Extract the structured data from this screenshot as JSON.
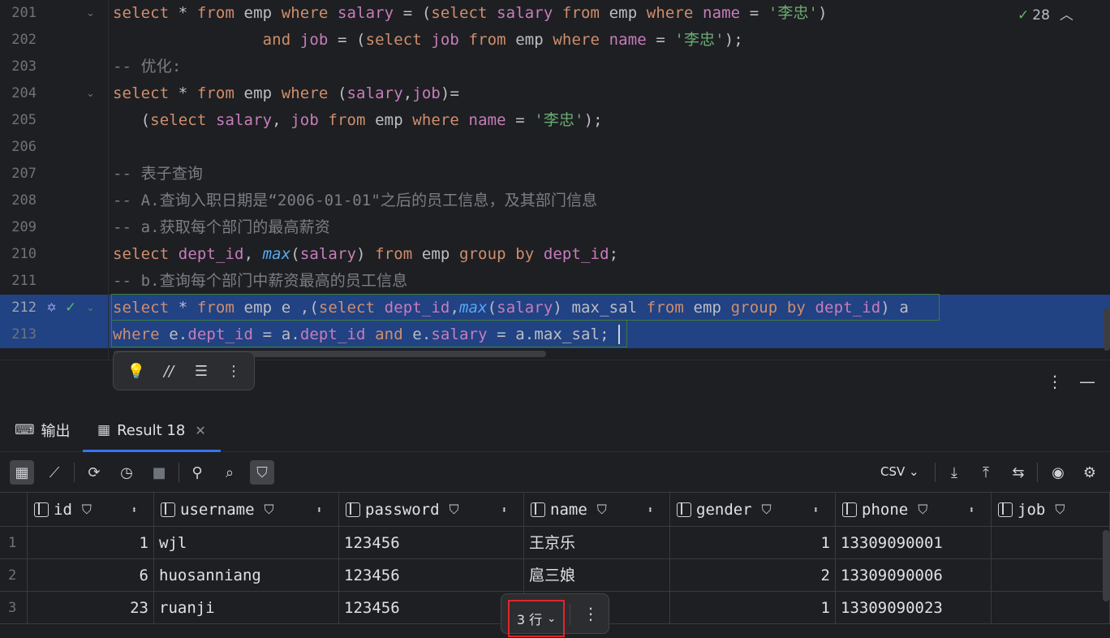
{
  "editor": {
    "lines": [
      {
        "num": "201",
        "fold": "⌄",
        "tokens": [
          {
            "t": "kw",
            "v": "select"
          },
          {
            "t": "",
            "v": " * "
          },
          {
            "t": "kw",
            "v": "from"
          },
          {
            "t": "",
            "v": " emp "
          },
          {
            "t": "kw",
            "v": "where"
          },
          {
            "t": "",
            "v": " "
          },
          {
            "t": "fld",
            "v": "salary"
          },
          {
            "t": "",
            "v": " = ("
          },
          {
            "t": "kw",
            "v": "select"
          },
          {
            "t": "",
            "v": " "
          },
          {
            "t": "fld",
            "v": "salary"
          },
          {
            "t": "",
            "v": " "
          },
          {
            "t": "kw",
            "v": "from"
          },
          {
            "t": "",
            "v": " emp "
          },
          {
            "t": "kw",
            "v": "where"
          },
          {
            "t": "",
            "v": " "
          },
          {
            "t": "fld",
            "v": "name"
          },
          {
            "t": "",
            "v": " = "
          },
          {
            "t": "str",
            "v": "'李忠'"
          },
          {
            "t": "",
            "v": ")"
          }
        ]
      },
      {
        "num": "202",
        "fold": "",
        "tokens": [
          {
            "t": "",
            "v": "                "
          },
          {
            "t": "kw",
            "v": "and"
          },
          {
            "t": "",
            "v": " "
          },
          {
            "t": "fld",
            "v": "job"
          },
          {
            "t": "",
            "v": " = ("
          },
          {
            "t": "kw",
            "v": "select"
          },
          {
            "t": "",
            "v": " "
          },
          {
            "t": "fld",
            "v": "job"
          },
          {
            "t": "",
            "v": " "
          },
          {
            "t": "kw",
            "v": "from"
          },
          {
            "t": "",
            "v": " emp "
          },
          {
            "t": "kw",
            "v": "where"
          },
          {
            "t": "",
            "v": " "
          },
          {
            "t": "fld",
            "v": "name"
          },
          {
            "t": "",
            "v": " = "
          },
          {
            "t": "str",
            "v": "'李忠'"
          },
          {
            "t": "",
            "v": ");"
          }
        ]
      },
      {
        "num": "203",
        "fold": "",
        "tokens": [
          {
            "t": "cmt",
            "v": "-- 优化:"
          }
        ]
      },
      {
        "num": "204",
        "fold": "⌄",
        "tokens": [
          {
            "t": "kw",
            "v": "select"
          },
          {
            "t": "",
            "v": " * "
          },
          {
            "t": "kw",
            "v": "from"
          },
          {
            "t": "",
            "v": " emp "
          },
          {
            "t": "kw",
            "v": "where"
          },
          {
            "t": "",
            "v": " ("
          },
          {
            "t": "fld",
            "v": "salary"
          },
          {
            "t": "",
            "v": ","
          },
          {
            "t": "fld",
            "v": "job"
          },
          {
            "t": "",
            "v": ")="
          }
        ]
      },
      {
        "num": "205",
        "fold": "",
        "tokens": [
          {
            "t": "",
            "v": "   ("
          },
          {
            "t": "kw",
            "v": "select"
          },
          {
            "t": "",
            "v": " "
          },
          {
            "t": "fld",
            "v": "salary"
          },
          {
            "t": "",
            "v": ", "
          },
          {
            "t": "fld",
            "v": "job"
          },
          {
            "t": "",
            "v": " "
          },
          {
            "t": "kw",
            "v": "from"
          },
          {
            "t": "",
            "v": " emp "
          },
          {
            "t": "kw",
            "v": "where"
          },
          {
            "t": "",
            "v": " "
          },
          {
            "t": "fld",
            "v": "name"
          },
          {
            "t": "",
            "v": " = "
          },
          {
            "t": "str",
            "v": "'李忠'"
          },
          {
            "t": "",
            "v": ");"
          }
        ]
      },
      {
        "num": "206",
        "fold": "",
        "tokens": []
      },
      {
        "num": "207",
        "fold": "",
        "tokens": [
          {
            "t": "cmt",
            "v": "-- 表子查询"
          }
        ]
      },
      {
        "num": "208",
        "fold": "",
        "tokens": [
          {
            "t": "cmt",
            "v": "-- A.查询入职日期是“2006-01-01\"之后的员工信息，及其部门信息"
          }
        ]
      },
      {
        "num": "209",
        "fold": "",
        "tokens": [
          {
            "t": "cmt",
            "v": "-- a.获取每个部门的最高薪资"
          }
        ]
      },
      {
        "num": "210",
        "fold": "",
        "tokens": [
          {
            "t": "kw",
            "v": "select"
          },
          {
            "t": "",
            "v": " "
          },
          {
            "t": "fld",
            "v": "dept_id"
          },
          {
            "t": "",
            "v": ", "
          },
          {
            "t": "fn",
            "v": "max"
          },
          {
            "t": "",
            "v": "("
          },
          {
            "t": "fld",
            "v": "salary"
          },
          {
            "t": "",
            "v": ") "
          },
          {
            "t": "kw",
            "v": "from"
          },
          {
            "t": "",
            "v": " emp "
          },
          {
            "t": "kw",
            "v": "group by"
          },
          {
            "t": "",
            "v": " "
          },
          {
            "t": "fld",
            "v": "dept_id"
          },
          {
            "t": "",
            "v": ";"
          }
        ]
      },
      {
        "num": "211",
        "fold": "",
        "tokens": [
          {
            "t": "cmt",
            "v": "-- b.查询每个部门中薪资最高的员工信息"
          }
        ]
      },
      {
        "num": "212",
        "fold": "⌄",
        "selected": true,
        "current": true,
        "tokens": [
          {
            "t": "kw",
            "v": "select"
          },
          {
            "t": "",
            "v": " * "
          },
          {
            "t": "kw",
            "v": "from"
          },
          {
            "t": "",
            "v": " emp e ,("
          },
          {
            "t": "kw",
            "v": "select"
          },
          {
            "t": "",
            "v": " "
          },
          {
            "t": "fld",
            "v": "dept_id"
          },
          {
            "t": "",
            "v": ","
          },
          {
            "t": "fn",
            "v": "max"
          },
          {
            "t": "",
            "v": "("
          },
          {
            "t": "fld",
            "v": "salary"
          },
          {
            "t": "",
            "v": ") max_sal "
          },
          {
            "t": "kw",
            "v": "from"
          },
          {
            "t": "",
            "v": " emp "
          },
          {
            "t": "kw",
            "v": "group by"
          },
          {
            "t": "",
            "v": " "
          },
          {
            "t": "fld",
            "v": "dept_id"
          },
          {
            "t": "",
            "v": ") a"
          }
        ]
      },
      {
        "num": "213",
        "fold": "",
        "selected": true,
        "tokens": [
          {
            "t": "kw",
            "v": "where"
          },
          {
            "t": "",
            "v": " e."
          },
          {
            "t": "fld",
            "v": "dept_id"
          },
          {
            "t": "",
            "v": " = a."
          },
          {
            "t": "fld",
            "v": "dept_id"
          },
          {
            "t": "",
            "v": " "
          },
          {
            "t": "kw",
            "v": "and"
          },
          {
            "t": "",
            "v": " e."
          },
          {
            "t": "fld",
            "v": "salary"
          },
          {
            "t": "",
            "v": " = a.max_sal;"
          }
        ]
      }
    ],
    "inspection_count": "28"
  },
  "tabs": [
    {
      "label": "输出",
      "icon": "terminal-icon"
    },
    {
      "label": "Result 18",
      "icon": "table-icon",
      "active": true
    }
  ],
  "toolbar": {
    "format": "CSV"
  },
  "grid": {
    "columns": [
      "id",
      "username",
      "password",
      "name",
      "gender",
      "phone",
      "job"
    ],
    "rows": [
      {
        "rn": "1",
        "cells": [
          "1",
          "wjl",
          "123456",
          "王京乐",
          "1",
          "13309090001",
          ""
        ]
      },
      {
        "rn": "2",
        "cells": [
          "6",
          "huosanniang",
          "123456",
          "扈三娘",
          "2",
          "13309090006",
          ""
        ]
      },
      {
        "rn": "3",
        "cells": [
          "23",
          "ruanji",
          "123456",
          "",
          "1",
          "13309090023",
          ""
        ]
      }
    ],
    "row_count": "3 行"
  },
  "colors": {
    "selection": "#214283",
    "keyword": "#cf8e6d",
    "field": "#c77dbb",
    "string": "#6aab73",
    "comment": "#7a7e85",
    "accent": "#3574f0",
    "highlight_box": "#e0262b"
  }
}
